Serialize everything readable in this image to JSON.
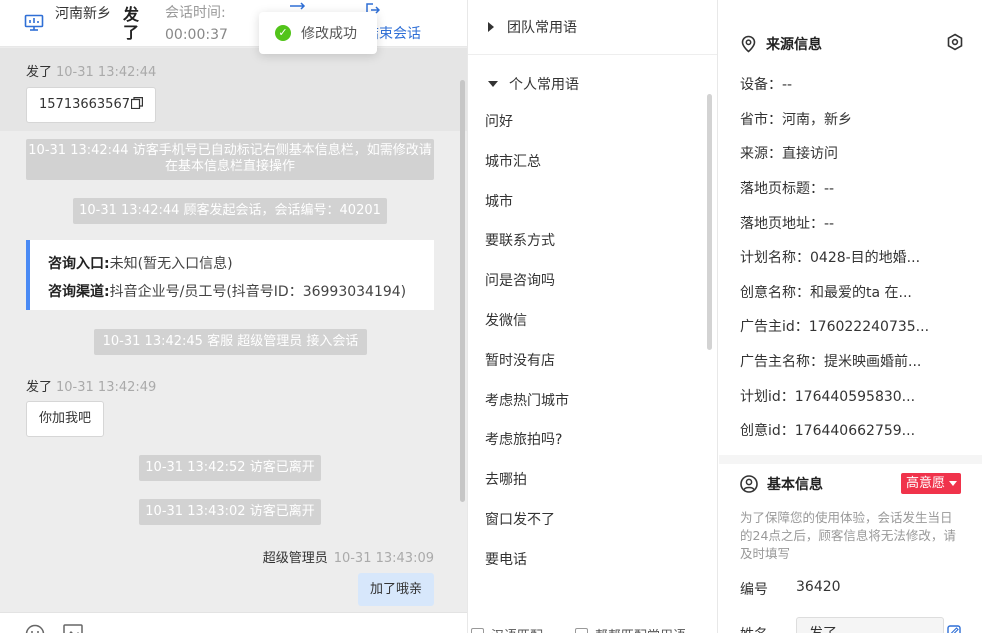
{
  "header": {
    "location": "河南新乡",
    "visitor_name": "发了",
    "time_label": "会话时间:",
    "time_value": "00:00:37",
    "end_chat_label": "结束会话"
  },
  "toast": {
    "text": "修改成功"
  },
  "chat": {
    "messages": [
      {
        "sender": "发了",
        "time": "10-31 13:42:44",
        "text": "15713663567"
      }
    ],
    "system_1": "10-31 13:42:44 访客手机号已自动标记右侧基本信息栏，如需修改请在基本信息栏直接操作",
    "system_2": "10-31 13:42:44 顾客发起会话，会话编号：40201",
    "entry_card": {
      "entry_label": "咨询入口:",
      "entry_value": "未知(暂无入口信息)",
      "channel_label": "咨询渠道:",
      "channel_value": "抖音企业号/员工号(抖音号ID：36993034194)"
    },
    "system_3": "10-31 13:42:45 客服 超级管理员 接入会话",
    "message_2": {
      "sender": "发了",
      "time": "10-31 13:42:49",
      "text": "你加我吧"
    },
    "system_4": "10-31 13:42:52 访客已离开",
    "system_5": "10-31 13:43:02 访客已离开",
    "agent_message": {
      "sender": "超级管理员",
      "time": "10-31 13:43:09",
      "text": "加了哦亲"
    }
  },
  "phrases": {
    "team_group": "团队常用语",
    "personal_group": "个人常用语",
    "items": [
      "问好",
      "城市汇总",
      "城市",
      "要联系方式",
      "问是咨询吗",
      "发微信",
      "暂时没有店",
      "考虑热门城市",
      "考虑旅拍吗?",
      "去哪拍",
      "窗口发不了",
      "要电话"
    ],
    "bottom_option_1": "汉语匹配",
    "bottom_option_2": "帮帮匹配常用语"
  },
  "source_info": {
    "title": "来源信息",
    "rows": [
      "设备：--",
      "省市：河南，新乡",
      "来源：直接访问",
      "落地页标题：--",
      "落地页地址：--",
      "计划名称：0428-目的地婚...",
      "创意名称：和最爱的ta 在...",
      "广告主id：176022240735...",
      "广告主名称：提米映画婚前...",
      "计划id：176440595830...",
      "创意id：176440662759..."
    ]
  },
  "basic_info": {
    "title": "基本信息",
    "intent_tag": "高意愿",
    "notice": "为了保障您的使用体验，会话发生当日的24点之后，顾客信息将无法修改，请及时填写",
    "id_label": "编号",
    "id_value": "36420",
    "name_label": "姓名",
    "name_value": "发了"
  },
  "colors": {
    "accent": "#2f6fd6",
    "intent_tag": "#f0334b",
    "success": "#52c41a",
    "agent_bubble": "#d7e7fb"
  }
}
